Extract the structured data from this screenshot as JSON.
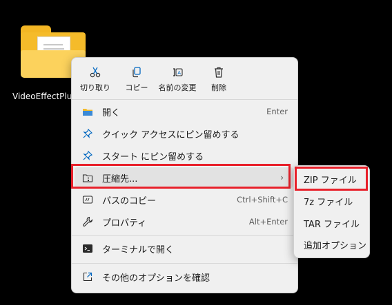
{
  "desktop": {
    "folder_label": "VideoEffectPlug"
  },
  "quick_actions": [
    {
      "label": "切り取り",
      "icon": "cut-icon"
    },
    {
      "label": "コピー",
      "icon": "copy-icon"
    },
    {
      "label": "名前の変更",
      "icon": "rename-icon"
    },
    {
      "label": "削除",
      "icon": "delete-icon"
    }
  ],
  "menu_items": [
    {
      "label": "開く",
      "shortcut": "Enter",
      "icon": "folder-icon"
    },
    {
      "label": "クイック アクセスにピン留めする",
      "shortcut": "",
      "icon": "pin-icon"
    },
    {
      "label": "スタート にピン留めする",
      "shortcut": "",
      "icon": "pin-icon"
    },
    {
      "label": "圧縮先...",
      "shortcut": "",
      "icon": "zip-folder-icon",
      "has_submenu": true
    },
    {
      "label": "パスのコピー",
      "shortcut": "Ctrl+Shift+C",
      "icon": "copy-path-icon"
    },
    {
      "label": "プロパティ",
      "shortcut": "Alt+Enter",
      "icon": "wrench-icon"
    },
    {
      "label": "ターミナルで開く",
      "shortcut": "",
      "icon": "terminal-icon"
    },
    {
      "label": "その他のオプションを確認",
      "shortcut": "",
      "icon": "more-options-icon"
    }
  ],
  "submenu": {
    "items": [
      {
        "label": "ZIP ファイル"
      },
      {
        "label": "7z ファイル"
      },
      {
        "label": "TAR ファイル"
      },
      {
        "label": "追加オプション"
      }
    ]
  },
  "colors": {
    "highlight": "#e8202a",
    "menu_bg": "#f0f0f0",
    "accent": "#0067c0"
  }
}
